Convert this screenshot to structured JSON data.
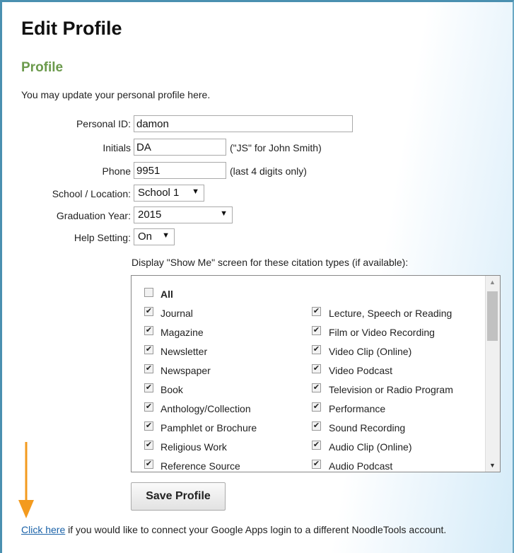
{
  "page": {
    "title": "Edit Profile",
    "section": "Profile",
    "intro": "You may update your personal profile here."
  },
  "form": {
    "personal_id": {
      "label": "Personal ID:",
      "value": "damon"
    },
    "initials": {
      "label": "Initials",
      "value": "DA",
      "hint": "(\"JS\" for John Smith)"
    },
    "phone": {
      "label": "Phone",
      "value": "9951",
      "hint": "(last 4 digits only)"
    },
    "school": {
      "label": "School / Location:",
      "value": "School 1"
    },
    "graduation": {
      "label": "Graduation Year:",
      "value": "2015"
    },
    "help": {
      "label": "Help Setting:",
      "value": "On"
    }
  },
  "show_me": {
    "label": "Display \"Show Me\" screen for these citation types (if available):",
    "all_label": "All",
    "all_checked": false,
    "left": [
      {
        "label": "Journal",
        "checked": true
      },
      {
        "label": "Magazine",
        "checked": true
      },
      {
        "label": "Newsletter",
        "checked": true
      },
      {
        "label": "Newspaper",
        "checked": true
      },
      {
        "label": "Book",
        "checked": true
      },
      {
        "label": "Anthology/Collection",
        "checked": true
      },
      {
        "label": "Pamphlet or Brochure",
        "checked": true
      },
      {
        "label": "Religious Work",
        "checked": true
      },
      {
        "label": "Reference Source",
        "checked": true
      }
    ],
    "right": [
      {
        "label": "Lecture, Speech or Reading",
        "checked": true
      },
      {
        "label": "Film or Video Recording",
        "checked": true
      },
      {
        "label": "Video Clip (Online)",
        "checked": true
      },
      {
        "label": "Video Podcast",
        "checked": true
      },
      {
        "label": "Television or Radio Program",
        "checked": true
      },
      {
        "label": "Performance",
        "checked": true
      },
      {
        "label": "Sound Recording",
        "checked": true
      },
      {
        "label": "Audio Clip (Online)",
        "checked": true
      },
      {
        "label": "Audio Podcast",
        "checked": true
      }
    ]
  },
  "save_label": "Save Profile",
  "footer": {
    "link": "Click here",
    "text": " if you would like to connect your Google Apps login to a different NoodleTools account."
  },
  "colors": {
    "annotation_arrow": "#f39a1e",
    "section_heading": "#6b9a4c",
    "link": "#1a62a8"
  }
}
